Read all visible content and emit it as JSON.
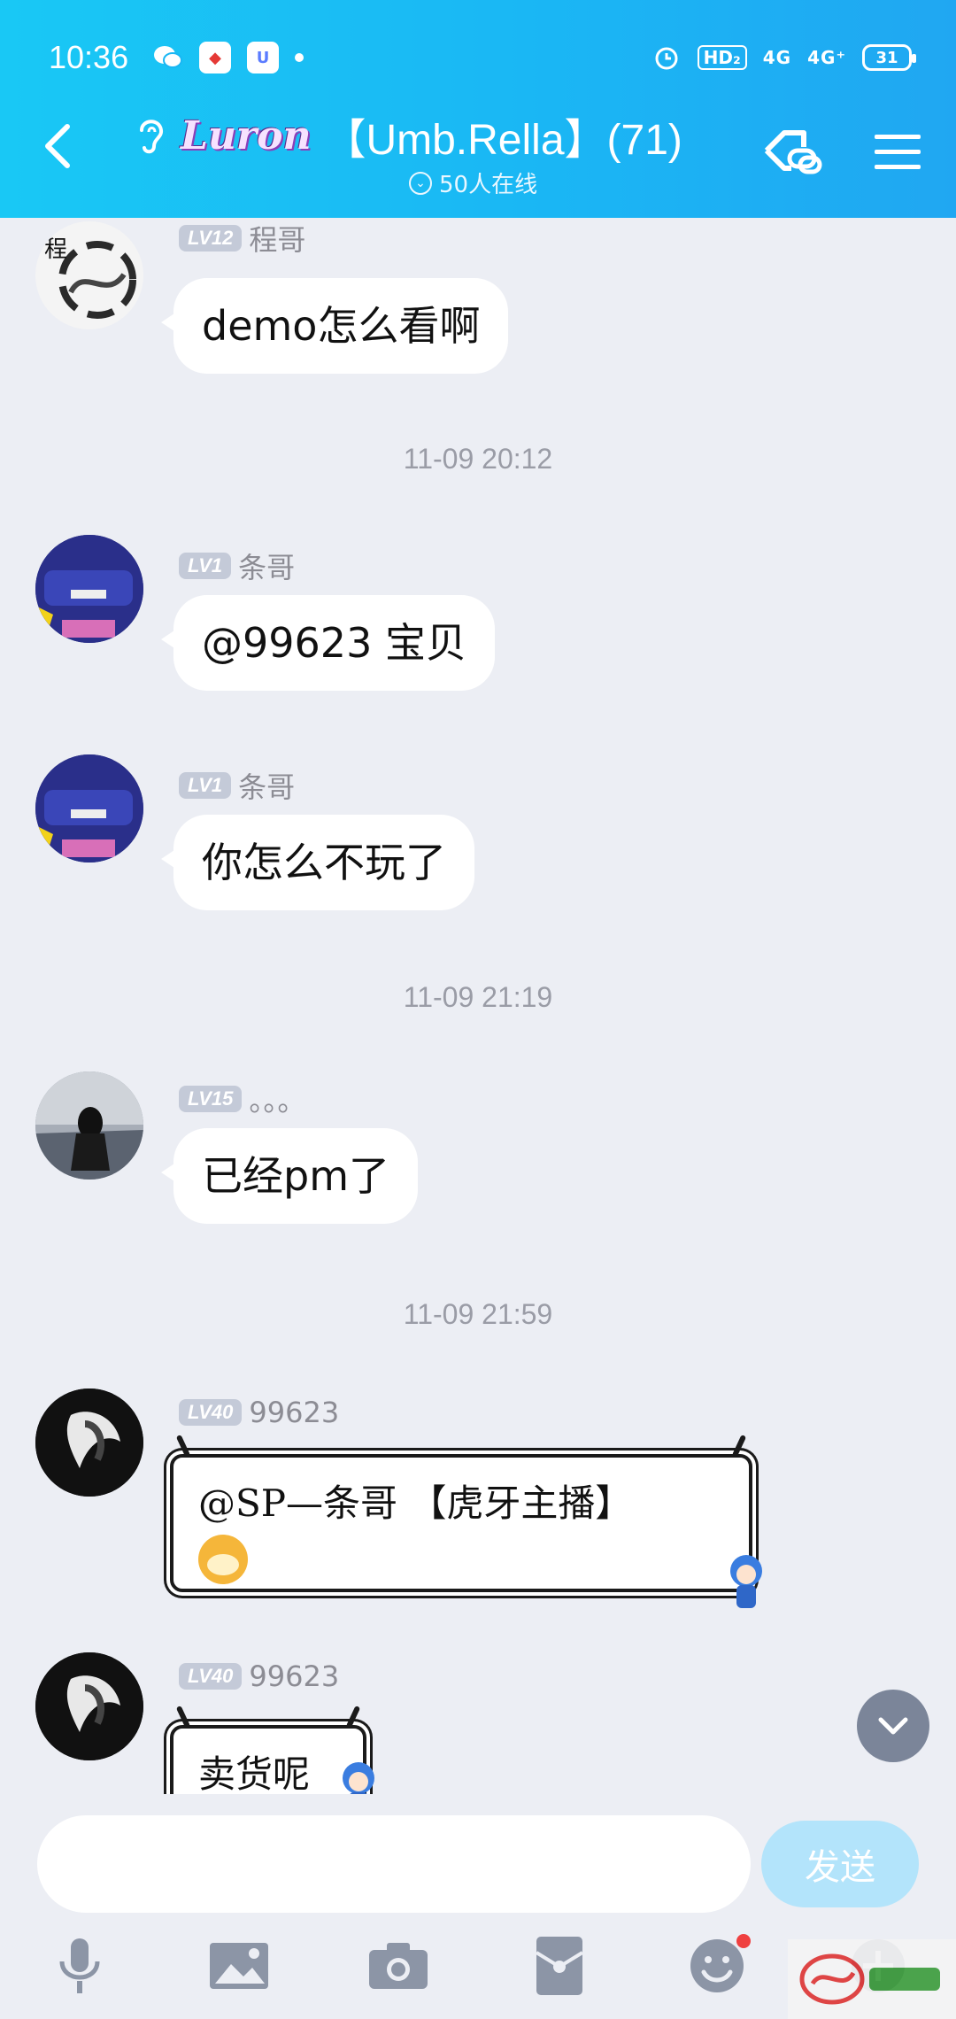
{
  "status_bar": {
    "time": "10:36",
    "network_label": "HD₂",
    "signal_1": "4G",
    "signal_2": "4G⁺",
    "battery": "31"
  },
  "header": {
    "brand": "Luron",
    "title": "【Umb.Rella】(71)",
    "online": "50人在线"
  },
  "messages": [
    {
      "level": "LV12",
      "nick": "程哥",
      "text": "demo怎么看啊"
    },
    {
      "level": "LV1",
      "nick": "条哥",
      "text": "@99623 宝贝"
    },
    {
      "level": "LV1",
      "nick": "条哥",
      "text": "你怎么不玩了"
    },
    {
      "level": "LV15",
      "nick": "。。。",
      "text": "已经pm了"
    },
    {
      "level": "LV40",
      "nick": "99623",
      "text": "@SP—条哥 【虎牙主播】"
    },
    {
      "level": "LV40",
      "nick": "99623",
      "text": "卖货呢"
    }
  ],
  "timestamps": [
    "11-09 20:12",
    "11-09 21:19",
    "11-09 21:59"
  ],
  "input": {
    "placeholder": "",
    "send_label": "发送"
  },
  "icons": {
    "back": "back-arrow-icon",
    "ear": "ear-icon",
    "link": "group-link-icon",
    "menu": "menu-icon",
    "scroll": "chevron-down-icon",
    "toolbar": [
      "microphone-icon",
      "image-icon",
      "camera-icon",
      "red-packet-icon",
      "emoji-icon",
      "plus-icon"
    ]
  },
  "colors": {
    "header": "#1ab7f4",
    "send_button": "#b3e4fb",
    "bubble": "#ffffff",
    "background": "#eceef4"
  }
}
